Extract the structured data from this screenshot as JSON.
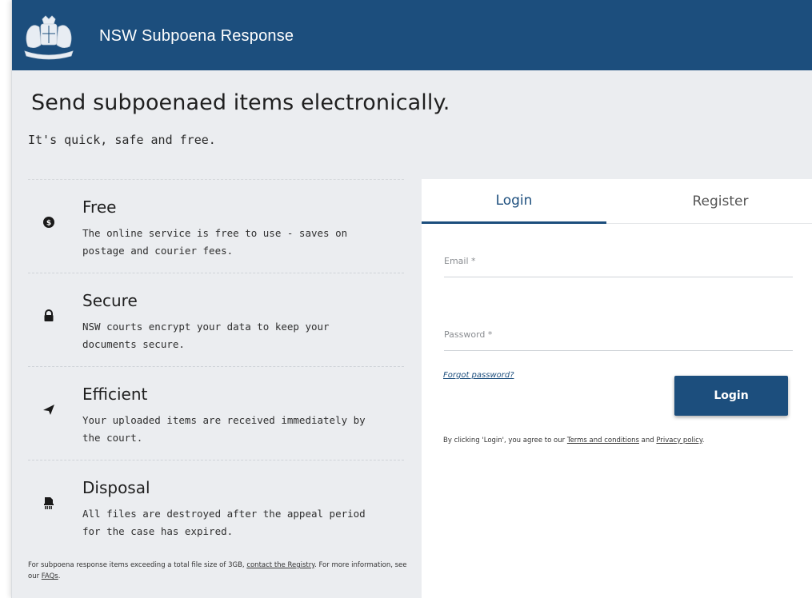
{
  "header": {
    "title": "NSW Subpoena Response",
    "logo": "nsw-coat-of-arms"
  },
  "hero": {
    "headline": "Send subpoenaed items electronically.",
    "subline": "It's quick, safe and free."
  },
  "features": [
    {
      "icon": "dollar-coin-icon",
      "title": "Free",
      "desc": "The online service is free to use - saves on postage and courier fees."
    },
    {
      "icon": "lock-icon",
      "title": "Secure",
      "desc": "NSW courts encrypt your data to keep your documents secure."
    },
    {
      "icon": "paper-plane-icon",
      "title": "Efficient",
      "desc": "Your uploaded items are received immediately by the court."
    },
    {
      "icon": "shredder-icon",
      "title": "Disposal",
      "desc": "All files are destroyed after the appeal period for the case has expired."
    }
  ],
  "footnote": {
    "prefix": "For subpoena response items exceeding a total file size of 3GB, ",
    "contact_link": "contact the Registry",
    "middle": ". For more information, see our ",
    "faq_link": "FAQs",
    "suffix": "."
  },
  "auth": {
    "tabs": [
      {
        "label": "Login",
        "active": true
      },
      {
        "label": "Register",
        "active": false
      }
    ],
    "email_placeholder": "Email *",
    "password_placeholder": "Password *",
    "forgot_label": "Forgot password?",
    "login_button": "Login",
    "agree_prefix": "By clicking 'Login', you agree to our ",
    "terms_link": "Terms and conditions",
    "agree_middle": " and ",
    "privacy_link": "Privacy policy",
    "agree_suffix": "."
  },
  "colors": {
    "brand": "#1c4e7d",
    "page_bg": "#ebedf0",
    "panel_bg": "#ffffff"
  }
}
